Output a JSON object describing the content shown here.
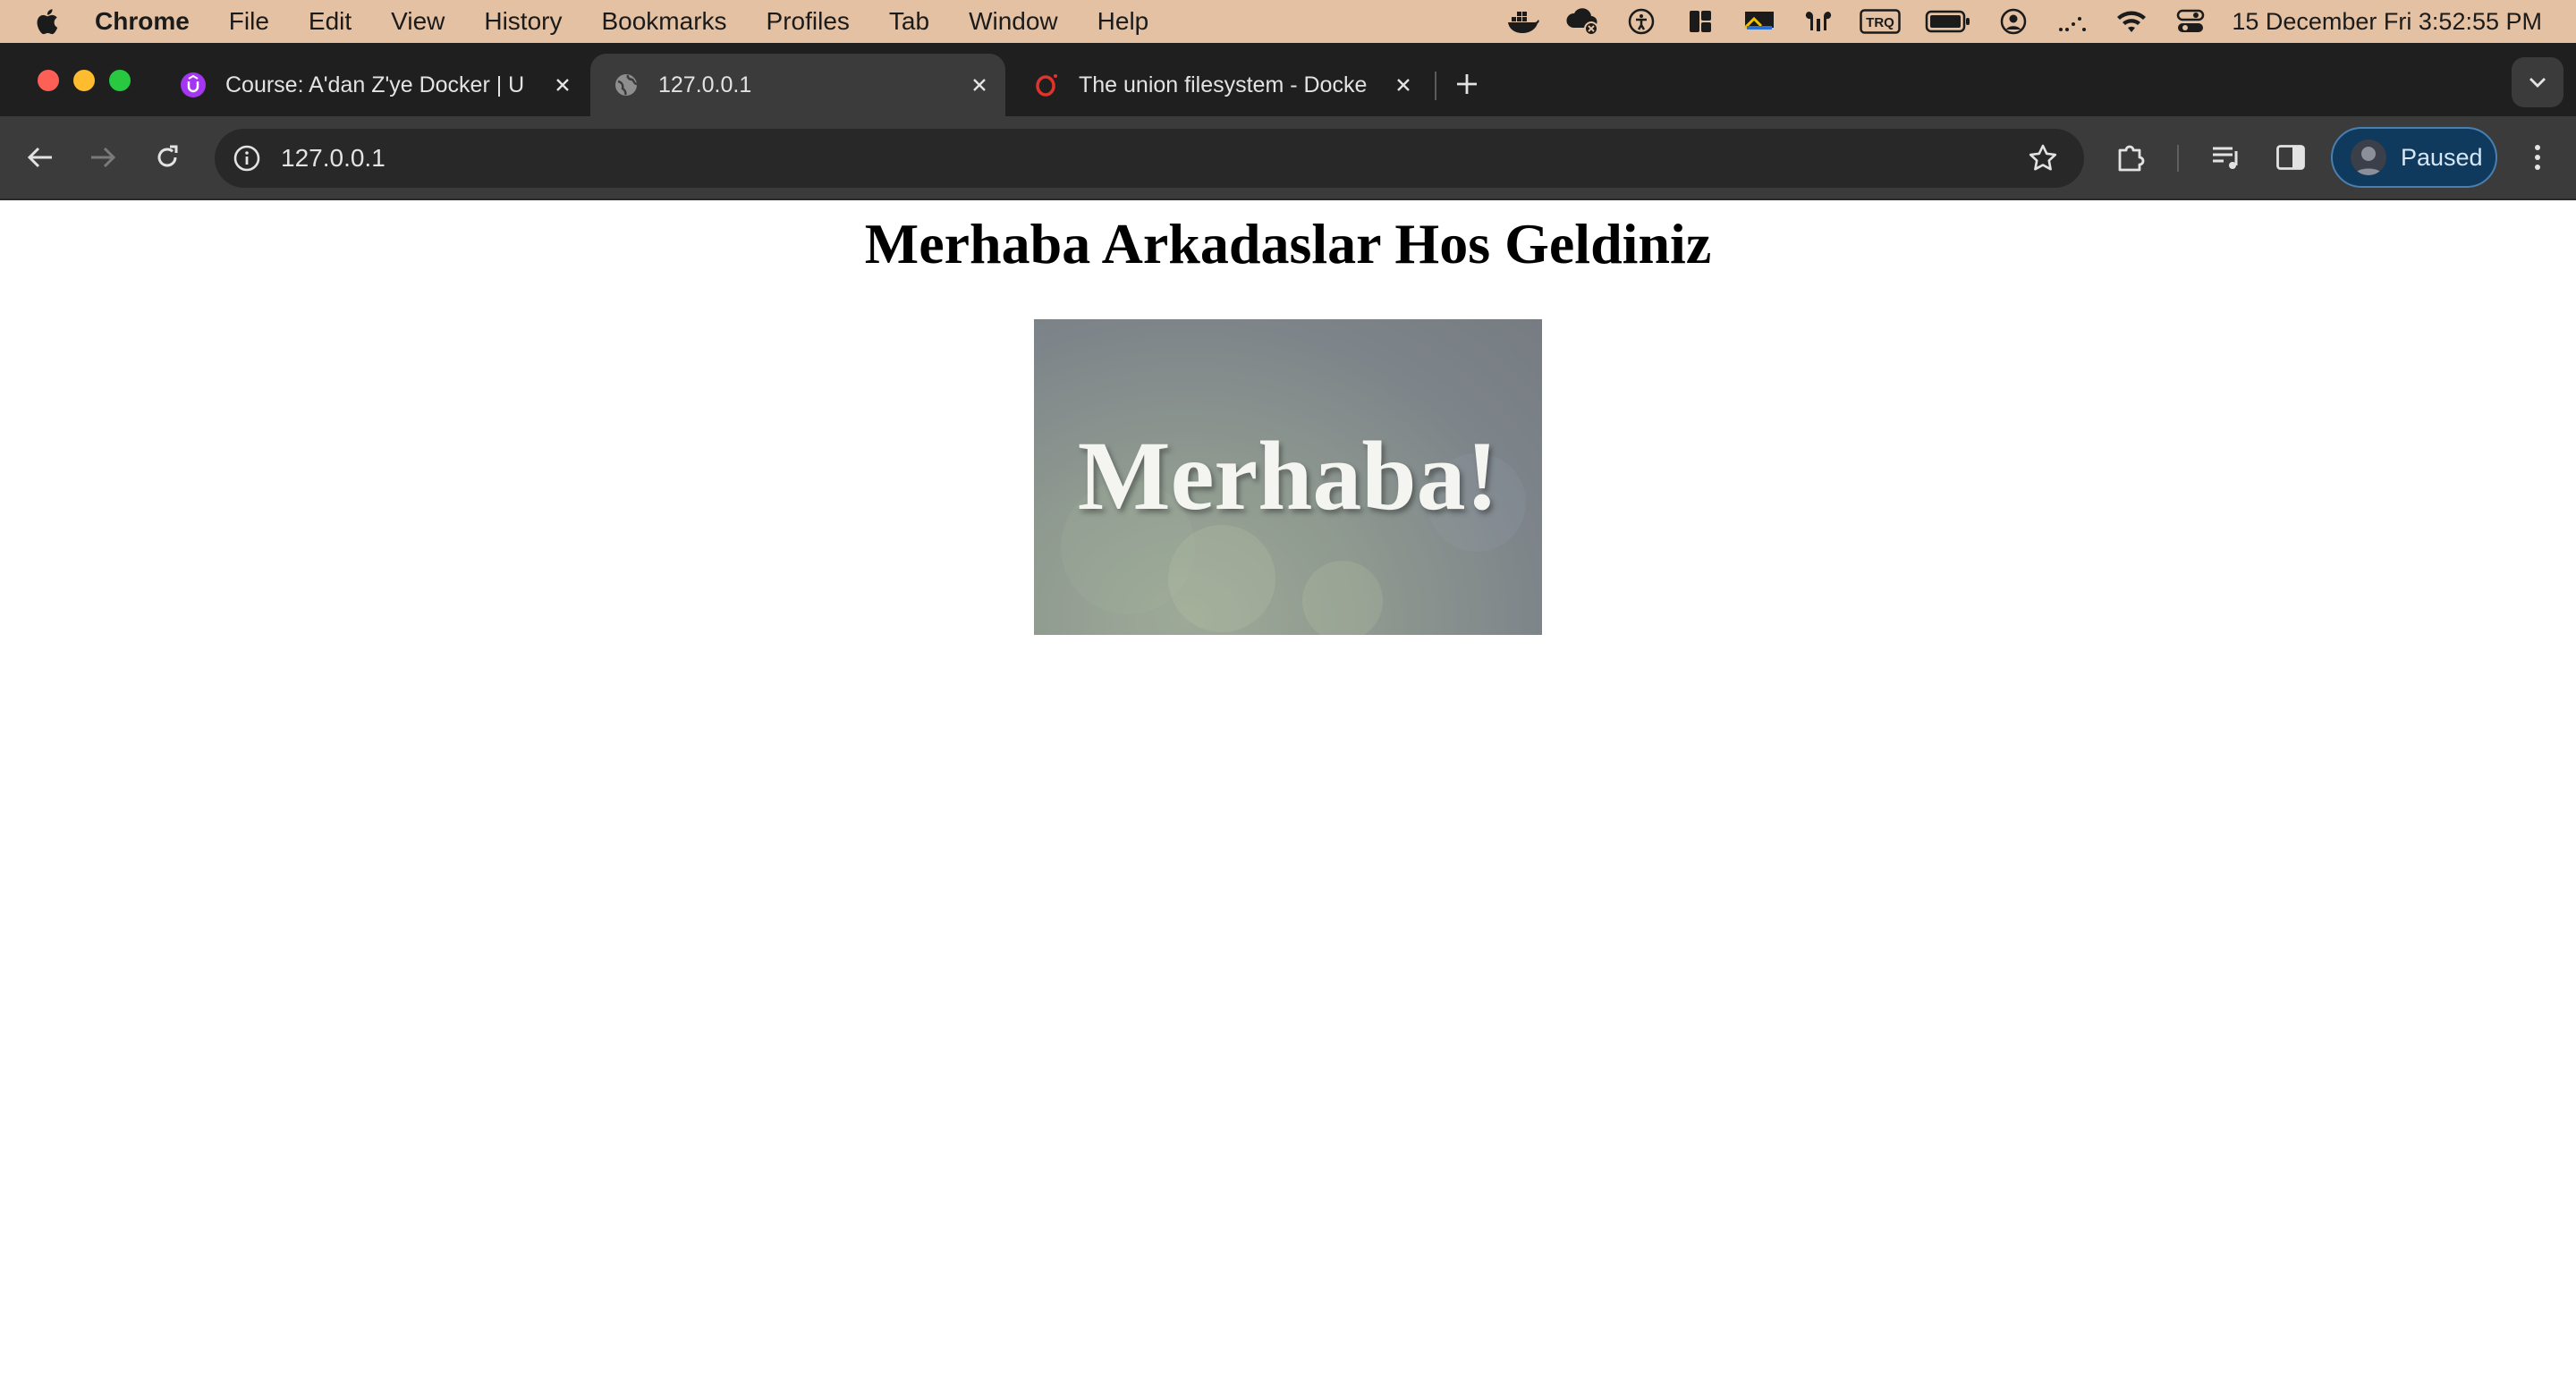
{
  "menubar": {
    "apple_icon": "apple-logo-icon",
    "items": [
      "Chrome",
      "File",
      "Edit",
      "View",
      "History",
      "Bookmarks",
      "Profiles",
      "Tab",
      "Window",
      "Help"
    ],
    "status_icons": [
      "docker-whale-icon",
      "cloud-sync-icon",
      "accessibility-icon",
      "window-layout-icon",
      "display-icon",
      "airpods-icon",
      "input-source-icon",
      "battery-icon",
      "user-account-icon",
      "network-activity-icon",
      "wifi-icon",
      "control-center-icon"
    ],
    "input_source": "TRQ",
    "clock": "15 December Fri  3:52:55 PM"
  },
  "browser": {
    "tabs": [
      {
        "title": "Course: A'dan Z'ye Docker | U",
        "icon": "udemy-icon",
        "active": false
      },
      {
        "title": "127.0.0.1",
        "icon": "globe-icon",
        "active": true
      },
      {
        "title": "The union filesystem - Docke",
        "icon": "opera-icon",
        "active": false
      }
    ],
    "url": "127.0.0.1",
    "profile_label": "Paused"
  },
  "page": {
    "heading": "Merhaba Arkadaslar Hos Geldiniz",
    "image_text": "Merhaba!"
  },
  "colors": {
    "menubar_bg": "#e3c1a2",
    "tabstrip_bg": "#1f1f1f",
    "toolbar_bg": "#3b3b3b",
    "omnibox_bg": "#282828",
    "profile_bg": "#0f3a5e"
  }
}
